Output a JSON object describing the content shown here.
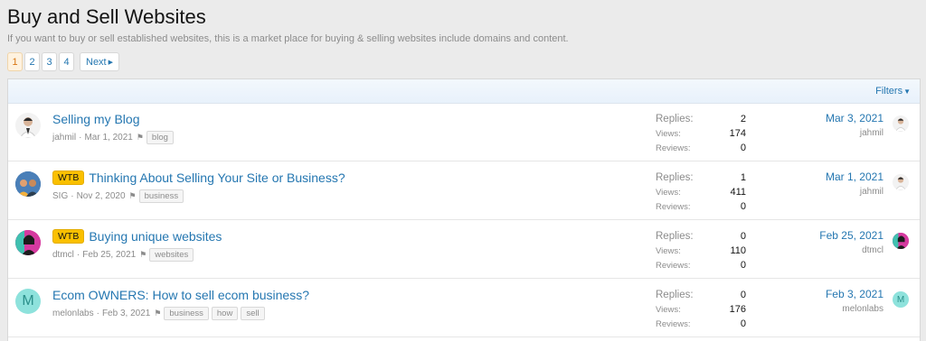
{
  "page": {
    "title": "Buy and Sell Websites",
    "description": "If you want to buy or sell established websites, this is a market place for buying & selling websites include domains and content."
  },
  "pager": {
    "pages": [
      "1",
      "2",
      "3",
      "4"
    ],
    "current": "1",
    "next_label": "Next"
  },
  "filters_label": "Filters",
  "stat_labels": {
    "replies": "Replies:",
    "views": "Views:",
    "reviews": "Reviews:"
  },
  "threads": [
    {
      "prefix": "",
      "title": "Selling my Blog",
      "author": "jahmil",
      "date": "Mar 1, 2021",
      "tags": [
        "blog"
      ],
      "replies": "2",
      "views": "174",
      "reviews": "0",
      "last_date": "Mar 3, 2021",
      "last_user": "jahmil",
      "avatar": "photo-man-icon"
    },
    {
      "prefix": "WTB",
      "title": "Thinking About Selling Your Site or Business?",
      "author": "SIG",
      "date": "Nov 2, 2020",
      "tags": [
        "business"
      ],
      "replies": "1",
      "views": "411",
      "reviews": "0",
      "last_date": "Mar 1, 2021",
      "last_user": "jahmil",
      "avatar": "photo-group-icon"
    },
    {
      "prefix": "WTB",
      "title": "Buying unique websites",
      "author": "dtmcl",
      "date": "Feb 25, 2021",
      "tags": [
        "websites"
      ],
      "replies": "0",
      "views": "110",
      "reviews": "0",
      "last_date": "Feb 25, 2021",
      "last_user": "dtmcl",
      "avatar": "photo-woman-icon"
    },
    {
      "prefix": "",
      "title": "Ecom OWNERS: How to sell ecom business?",
      "author": "melonlabs",
      "date": "Feb 3, 2021",
      "tags": [
        "business",
        "how",
        "sell"
      ],
      "replies": "0",
      "views": "176",
      "reviews": "0",
      "last_date": "Feb 3, 2021",
      "last_user": "melonlabs",
      "avatar": "letter-m-avatar",
      "avatar_letter": "M"
    }
  ],
  "colors": {
    "link": "#2577b1",
    "prefix_bg": "#fac000",
    "muted": "#8c8c8c",
    "letter_avatar_bg": "#8ee2dc"
  }
}
